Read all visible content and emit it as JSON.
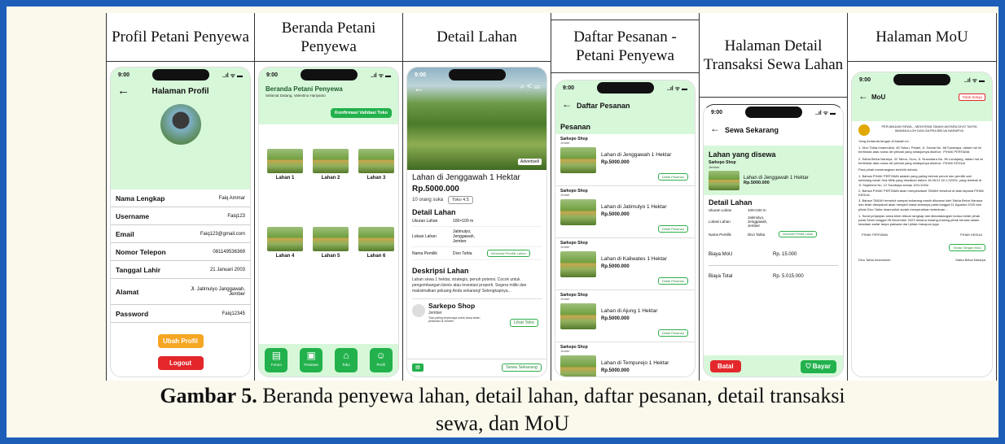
{
  "headers": {
    "c1": "Profil Petani Penyewa",
    "c2": "Beranda Petani Penyewa",
    "c3": "Detail Lahan",
    "c4": "Daftar Pesanan - Petani Penyewa",
    "c5": "Halaman Detail Transaksi Sewa Lahan",
    "c6": "Halaman MoU"
  },
  "status": {
    "time": "9:00",
    "signal": "..ıl ᯤ ▬"
  },
  "profile": {
    "title": "Halaman Profil",
    "rows": [
      {
        "k": "Nama Lengkap",
        "v": "Faiq Ammar"
      },
      {
        "k": "Username",
        "v": "Faiq123"
      },
      {
        "k": "Email",
        "v": "Faiq123@gmail.com"
      },
      {
        "k": "Nomor Telepon",
        "v": "081149536369"
      },
      {
        "k": "Tanggal Lahir",
        "v": "21 Januari 2003"
      },
      {
        "k": "Alamat",
        "v": "Jl. Jatimulyo Janggawah, Jember"
      },
      {
        "k": "Password",
        "v": "Faiq12345"
      }
    ],
    "edit": "Ubah Profil",
    "logout": "Logout"
  },
  "home": {
    "title": "Beranda Petani Penyewa",
    "subtitle": "Selamat Datang, Valentino Hariyanto",
    "badge": "Konfirmasi Validasi Toko",
    "lahan": [
      "Lahan 1",
      "Lahan 2",
      "Lahan 3",
      "Lahan 4",
      "Lahan 5",
      "Lahan 6"
    ],
    "nav": [
      "Forum",
      "Pesanan",
      "Toko",
      "Profil"
    ]
  },
  "detail": {
    "advert": "Advertisell",
    "name": "Lahan di Jenggawah 1 Hektar",
    "price": "Rp.5000.000",
    "rated": "10 orang suka",
    "rating": "Toko 4.5",
    "section": "Detail Lahan",
    "rows": [
      {
        "k": "Ukuran Lahan",
        "v": "100×100 m"
      },
      {
        "k": "Lokasi Lahan",
        "v": "Jatimulyo, Jenggawah, Jember"
      },
      {
        "k": "Nama Pemilik",
        "v": "Divo Tahta"
      }
    ],
    "info_btn": "Informasi Pemilik Lahan",
    "desc_title": "Deskripsi Lahan",
    "desc": "Lahan sewa 1 hektar, strategis, penuh potensi. Cocok untuk pengembangan bisnis atau investasi properti. Segera miliki dan maksimalkan peluang Anda sekarang! Selengkapnya...",
    "shop": "Sarkepo Shop",
    "shop_loc": "Jember",
    "shop_note": "Toko paling terpercaya untuk sewa lahan pertanian di Jember",
    "see_shop": "Lihat Toko",
    "rent_now": "Sewa Sekarang"
  },
  "orders": {
    "title": "Daftar Pesanan",
    "section": "Pesanan",
    "shop": "Sarkepo Shop",
    "sub": "Jember",
    "items": [
      {
        "name": "Lahan di Jenggawah 1 Hektar",
        "price": "Rp.5000.000"
      },
      {
        "name": "Lahan di Jatimulyo 1 Hektar",
        "price": "Rp.5000.000"
      },
      {
        "name": "Lahan di Kaliwates 1 Hektar",
        "price": "Rp.5000.000"
      },
      {
        "name": "Lahan di Ajung 1 Hektar",
        "price": "Rp.5000.000"
      },
      {
        "name": "Lahan di Tempurejo 1 Hektar",
        "price": "Rp.5000.000"
      }
    ],
    "detail_btn": "Detail Pesanan"
  },
  "trans": {
    "title": "Sewa Sekarang",
    "section": "Lahan yang disewa",
    "shop": "Sarkepo Shop",
    "sub": "Jember",
    "item": "Lahan di Jenggawah 1 Hektar",
    "price": "Rp.5000.000",
    "detail": "Detail Lahan",
    "rows": [
      {
        "k": "Ukuran Lahan",
        "v": "100×100 m"
      },
      {
        "k": "Lokasi Lahan",
        "v": "Jatimulyo, Jenggawah, Jember"
      },
      {
        "k": "Nama Pemilik",
        "v": "Divo Tahta"
      }
    ],
    "info_btn": "Informasi Pemilik Lahan",
    "biaya_mou": "Biaya MoU",
    "biaya_mou_v": "Rp. 15.000",
    "biaya_total": "Biaya Total",
    "biaya_total_v": "Rp. 5.015.000",
    "cancel": "Batal",
    "pay": "Bayar"
  },
  "mou": {
    "title": "MoU",
    "reject": "Tolak Setuju",
    "heading": "PERJANJIAN SEWA – MENYEWA TANAH ANTARA DIVO TAHTA IMANNULLOH DAN SATRIA BELVA NARARYA",
    "p1": "Yang bertanda tangan di bawah ini :",
    "p2": "1. Divo Tahta Imannulloh, 45 Tahun, Petani, Jl. Damai No. 88 Surabaya, dalam hal ini bertindak atas nama diri pribadi yang selanjutnya disebut : PIHAK PERTAMA",
    "p3": "2. Satria Belva Nararya, 32 Tahun, Guru, Jl. Nusantara No. 56 Lumajang, dalam hal ini bertindak atas nama diri pribadi yang selanjutnya disebut : PIHAK KEDUA",
    "p4": "Para pihak menerangkan terlebih dahulu:",
    "p5": "1. Bahwa PIHAK PERTAMA adalah yang paling berhak penuh dan pemilik sah sebidang tanah Hak Milik yang diuraikan dalam 16.08.01.02.1.02324, yang terletak di Jl. Sejahtera No. 12 Surabaya seluas 100×100m",
    "p6": "2. Bahwa PIHAK PERTAMA akan menyewakan TANAH tersebut di atas kepada PIHAK KEDUA",
    "p7": "3. Bahwa TANAH tersebut sampai sekarang masih dikuasai oleh Satria Belva Nararya dan telah disepakati akan menjadi masa sewanya pada tanggal 11 Agustus 2025 dan pihak Divo Tahta Imannulloh sudah menyerahkan ketentuan ...",
    "p8": "1. Surat perjanjian sewa telah dibuat rangkap dan ditandatangani kedua belah pihak pada Senin tanggal 28 November 2023 dimana masing-masing pihak berada dalam keadaan sadar tanpa paksaan dari pihak manapun juga",
    "first": "PIHAK PERTAMA",
    "second": "PIHAK KEDUA",
    "sign": "Tanda Tangan MoU",
    "name1": "Divo Tahta Imannulloh",
    "name2": "Satria Belva Nararya"
  },
  "caption": {
    "bold": "Gambar 5.",
    "rest": " Beranda penyewa lahan, detail lahan, daftar pesanan, detail transaksi",
    "line2": "sewa, dan MoU"
  }
}
